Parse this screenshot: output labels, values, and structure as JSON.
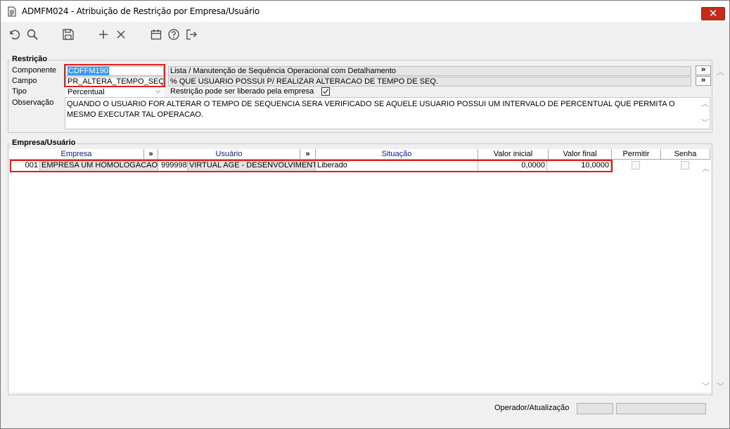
{
  "window": {
    "title": "ADMFM024 - Atribuição de Restrição por Empresa/Usuário",
    "close_label": "✕"
  },
  "toolbar": {
    "icons": [
      "undo-icon",
      "search-icon",
      "save-icon",
      "add-icon",
      "delete-icon",
      "calendar-icon",
      "help-icon",
      "exit-icon"
    ]
  },
  "restricao": {
    "legend": "Restrição",
    "componente_label": "Componente",
    "componente_value": "CDFFM190",
    "componente_desc": "Lista / Manutenção de Sequência Operacional com Detalhamento",
    "campo_label": "Campo",
    "campo_value": "PR_ALTERA_TEMPO_SEQ",
    "campo_desc": "% QUE USUARIO POSSUI P/ REALIZAR ALTERACAO DE TEMPO DE SEQ.",
    "tipo_label": "Tipo",
    "tipo_value": "Percentual",
    "liberado_label": "Restrição pode ser liberado pela empresa",
    "liberado_checked": true,
    "observacao_label": "Observação",
    "observacao_value": "QUANDO O USUARIO FOR ALTERAR O TEMPO DE SEQUENCIA SERA VERIFICADO SE AQUELE USUARIO POSSUI UM INTERVALO DE PERCENTUAL QUE PERMITA O MESMO EXECUTAR TAL OPERACAO.",
    "ellipsis_label": "»"
  },
  "empresa_usuario": {
    "legend": "Empresa/Usuário",
    "columns": {
      "empresa": "Empresa",
      "usuario": "Usuário",
      "situacao": "Situação",
      "valor_inicial": "Valor inicial",
      "valor_final": "Valor final",
      "permitir": "Permitir",
      "senha": "Senha",
      "expand": "»"
    },
    "rows": [
      {
        "empresa_code": "001",
        "empresa_name": "EMPRESA UM HOMOLOGACAO",
        "usuario_code": "999998",
        "usuario_name": "VIRTUAL AGE - DESENVOLVIMENTO",
        "situacao": "Liberado",
        "valor_inicial": "0,0000",
        "valor_final": "10,0000",
        "permitir": false,
        "senha": false
      }
    ]
  },
  "footer": {
    "operador_label": "Operador/Atualização",
    "operador_value": "",
    "atualizacao_value": ""
  },
  "colors": {
    "highlight": "#e02020",
    "selection": "#3399ff",
    "close": "#c42b1c",
    "header_blue": "#0a1aa8"
  }
}
